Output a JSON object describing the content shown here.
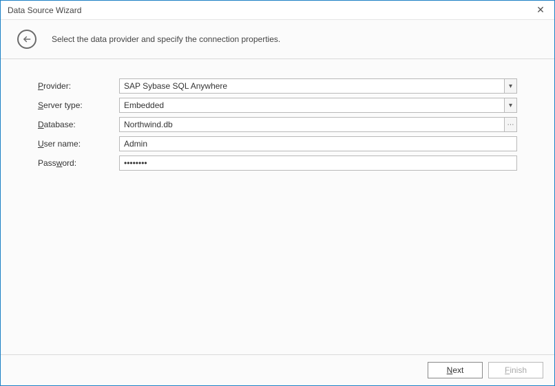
{
  "window": {
    "title": "Data Source Wizard",
    "close_glyph": "✕"
  },
  "header": {
    "back_arrow": "←",
    "instruction": "Select the data provider and specify the connection properties."
  },
  "form": {
    "provider": {
      "label_pre": "",
      "label_accel": "P",
      "label_post": "rovider:",
      "value": "SAP Sybase SQL Anywhere",
      "chevron": "▾"
    },
    "server_type": {
      "label_pre": "",
      "label_accel": "S",
      "label_post": "erver type:",
      "value": "Embedded",
      "chevron": "▾"
    },
    "database": {
      "label_pre": "",
      "label_accel": "D",
      "label_post": "atabase:",
      "value": "Northwind.db",
      "browse_glyph": "⋯"
    },
    "username": {
      "label_pre": "",
      "label_accel": "U",
      "label_post": "ser name:",
      "value": "Admin"
    },
    "password": {
      "label_pre": "Pass",
      "label_accel": "w",
      "label_post": "ord:",
      "value": "••••••••"
    }
  },
  "footer": {
    "next_pre": "",
    "next_accel": "N",
    "next_post": "ext",
    "finish_pre": "",
    "finish_accel": "F",
    "finish_post": "inish"
  }
}
